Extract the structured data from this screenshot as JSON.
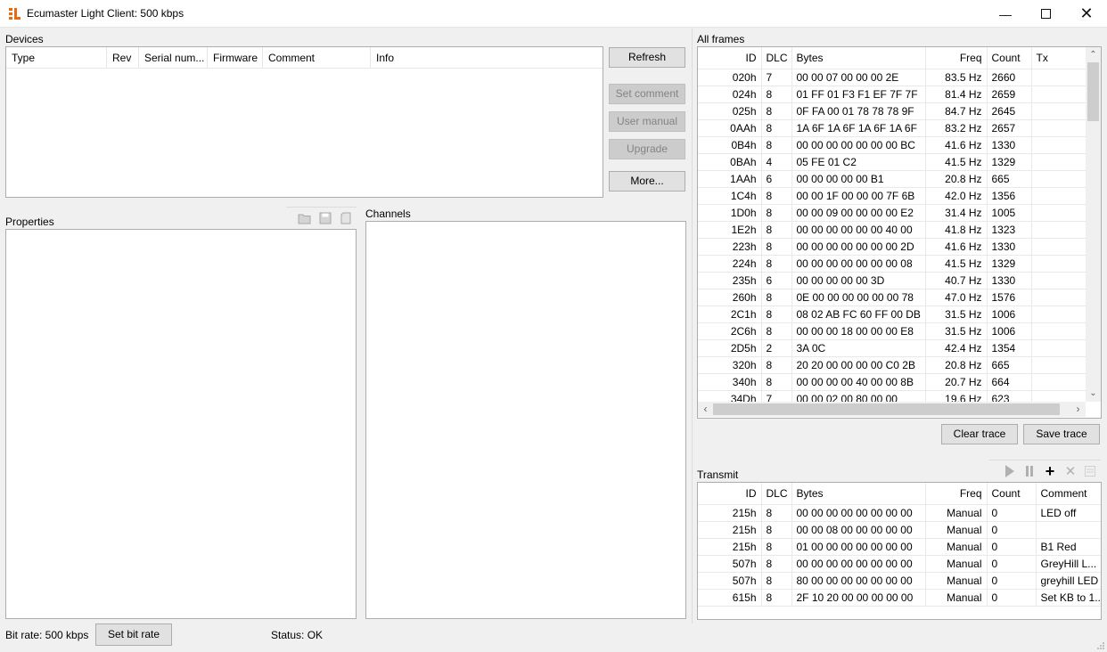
{
  "window": {
    "title": "Ecumaster Light Client: 500 kbps"
  },
  "devices": {
    "label": "Devices",
    "columns": [
      "Type",
      "Rev",
      "Serial num...",
      "Firmware",
      "Comment",
      "Info"
    ],
    "buttons": {
      "refresh": "Refresh",
      "set_comment": "Set comment",
      "user_manual": "User manual",
      "upgrade": "Upgrade",
      "more": "More..."
    }
  },
  "properties": {
    "label": "Properties"
  },
  "channels": {
    "label": "Channels"
  },
  "all_frames": {
    "label": "All frames",
    "columns": [
      "ID",
      "DLC",
      "Bytes",
      "Freq",
      "Count",
      "Tx"
    ],
    "rows": [
      [
        "020h",
        "7",
        "00 00 07 00  00 00 2E",
        "83.5 Hz",
        "2660",
        ""
      ],
      [
        "024h",
        "8",
        "01 FF 01 F3  F1 EF 7F 7F",
        "81.4 Hz",
        "2659",
        ""
      ],
      [
        "025h",
        "8",
        "0F FA 00 01  78 78 78 9F",
        "84.7 Hz",
        "2645",
        ""
      ],
      [
        "0AAh",
        "8",
        "1A 6F 1A 6F  1A 6F 1A 6F",
        "83.2 Hz",
        "2657",
        ""
      ],
      [
        "0B4h",
        "8",
        "00 00 00 00  00 00 00 BC",
        "41.6 Hz",
        "1330",
        ""
      ],
      [
        "0BAh",
        "4",
        "05 FE 01 C2",
        "41.5 Hz",
        "1329",
        ""
      ],
      [
        "1AAh",
        "6",
        "00 00 00 00  00 B1",
        "20.8 Hz",
        "665",
        ""
      ],
      [
        "1C4h",
        "8",
        "00 00 1F 00  00 00 7F 6B",
        "42.0 Hz",
        "1356",
        ""
      ],
      [
        "1D0h",
        "8",
        "00 00 09 00  00 00 00 E2",
        "31.4 Hz",
        "1005",
        ""
      ],
      [
        "1E2h",
        "8",
        "00 00 00 00  00 00 40 00",
        "41.8 Hz",
        "1323",
        ""
      ],
      [
        "223h",
        "8",
        "00 00 00 00  00 00 00 2D",
        "41.6 Hz",
        "1330",
        ""
      ],
      [
        "224h",
        "8",
        "00 00 00 00  00 00 00 08",
        "41.5 Hz",
        "1329",
        ""
      ],
      [
        "235h",
        "6",
        "00 00 00 00  00 3D",
        "40.7 Hz",
        "1330",
        ""
      ],
      [
        "260h",
        "8",
        "0E 00 00 00  00 00 00 78",
        "47.0 Hz",
        "1576",
        ""
      ],
      [
        "2C1h",
        "8",
        "08 02 AB FC  60 FF 00 DB",
        "31.5 Hz",
        "1006",
        ""
      ],
      [
        "2C6h",
        "8",
        "00 00 00 18  00 00 00 E8",
        "31.5 Hz",
        "1006",
        ""
      ],
      [
        "2D5h",
        "2",
        "3A 0C",
        "42.4 Hz",
        "1354",
        ""
      ],
      [
        "320h",
        "8",
        "20 20 00 00  00 00 C0 2B",
        "20.8 Hz",
        "665",
        ""
      ],
      [
        "340h",
        "8",
        "00 00 00 00  40 00 00 8B",
        "20.7 Hz",
        "664",
        ""
      ],
      [
        "34Dh",
        "7",
        "00 00 02 00  80 00 00",
        "19.6 Hz",
        "623",
        ""
      ]
    ],
    "buttons": {
      "clear_trace": "Clear trace",
      "save_trace": "Save trace"
    }
  },
  "transmit": {
    "label": "Transmit",
    "columns": [
      "ID",
      "DLC",
      "Bytes",
      "Freq",
      "Count",
      "Comment"
    ],
    "rows": [
      [
        "215h",
        "8",
        "00 00 00 00  00 00 00 00",
        "Manual",
        "0",
        "LED off"
      ],
      [
        "215h",
        "8",
        "00 00 08 00  00 00 00 00",
        "Manual",
        "0",
        ""
      ],
      [
        "215h",
        "8",
        "01 00 00 00  00 00 00 00",
        "Manual",
        "0",
        "B1 Red"
      ],
      [
        "507h",
        "8",
        "00 00 00 00  00 00 00 00",
        "Manual",
        "0",
        "GreyHill L..."
      ],
      [
        "507h",
        "8",
        "80 00 00 00  00 00 00 00",
        "Manual",
        "0",
        "greyhill LED"
      ],
      [
        "615h",
        "8",
        "2F 10 20 00  00 00 00 00",
        "Manual",
        "0",
        "Set KB to 1..."
      ]
    ]
  },
  "statusbar": {
    "bit_rate": "Bit rate: 500 kbps",
    "set_bit_rate": "Set bit rate",
    "status": "Status: OK"
  }
}
